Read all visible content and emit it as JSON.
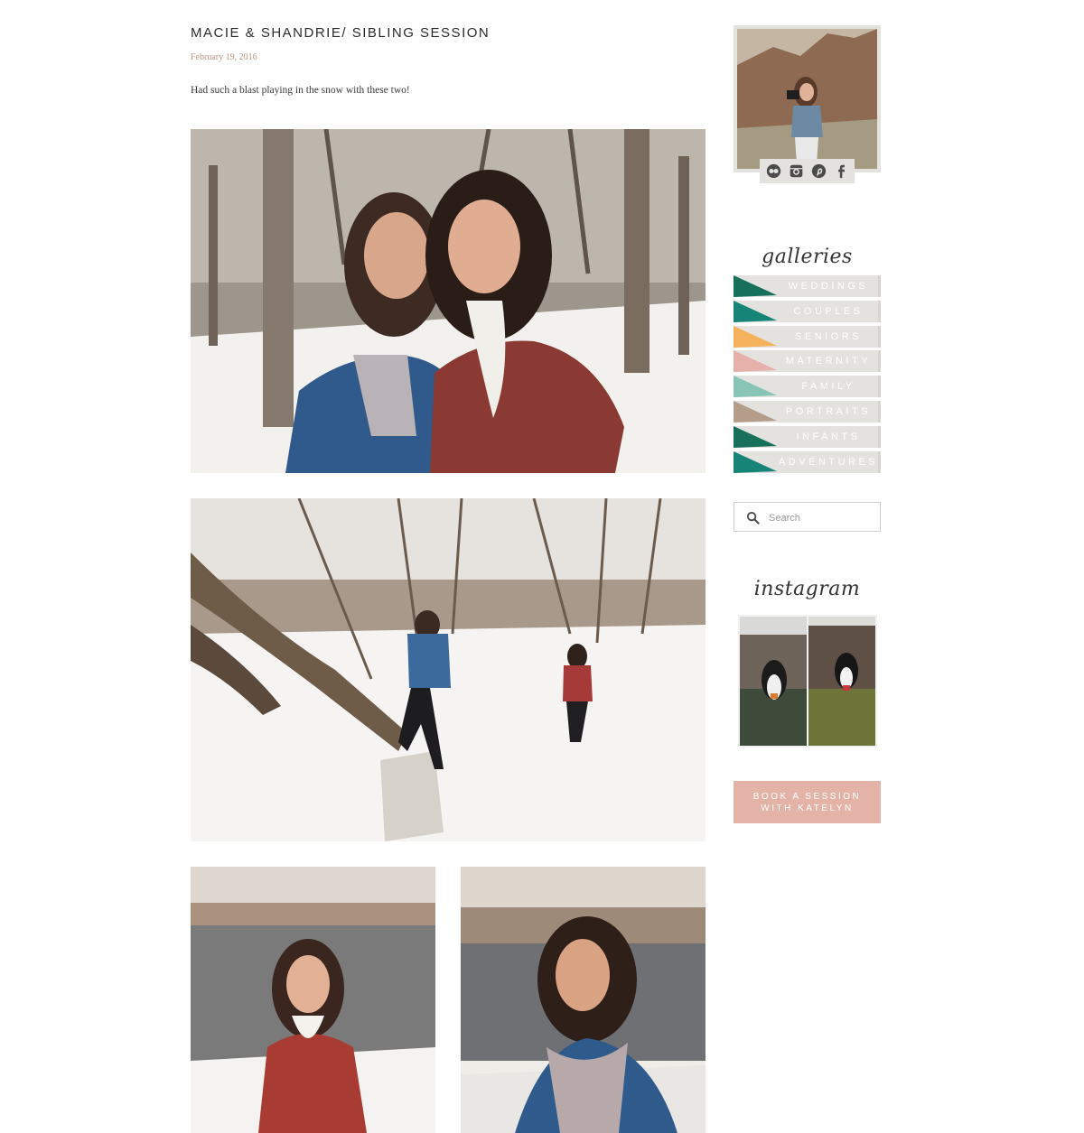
{
  "post": {
    "title": "MACIE & SHANDRIE/ SIBLING SESSION",
    "date": "February 19, 2016",
    "body": "Had such a blast playing in the snow with these two!"
  },
  "sidebar": {
    "social_icons": [
      "flickr-icon",
      "instagram-icon",
      "pinterest-icon",
      "facebook-icon"
    ],
    "galleries_heading": "galleries",
    "galleries": [
      {
        "label": "WEDDINGS",
        "color": "#16705a"
      },
      {
        "label": "COUPLES",
        "color": "#178478"
      },
      {
        "label": "SENIORS",
        "color": "#f6b15d"
      },
      {
        "label": "MATERNITY",
        "color": "#e6b1aa"
      },
      {
        "label": "FAMILY",
        "color": "#88c5b7"
      },
      {
        "label": "PORTRAITS",
        "color": "#b49d8a"
      },
      {
        "label": "INFANTS",
        "color": "#16705a"
      },
      {
        "label": "ADVENTURES",
        "color": "#178478"
      }
    ],
    "search": {
      "placeholder": "Search"
    },
    "instagram_heading": "instagram",
    "book_button": {
      "line1": "BOOK A SESSION",
      "line2": "WITH KATELYN"
    }
  },
  "colors": {
    "gallery_bg": "#e4e2df",
    "button": "#e4b3a8",
    "date": "#b79482"
  }
}
